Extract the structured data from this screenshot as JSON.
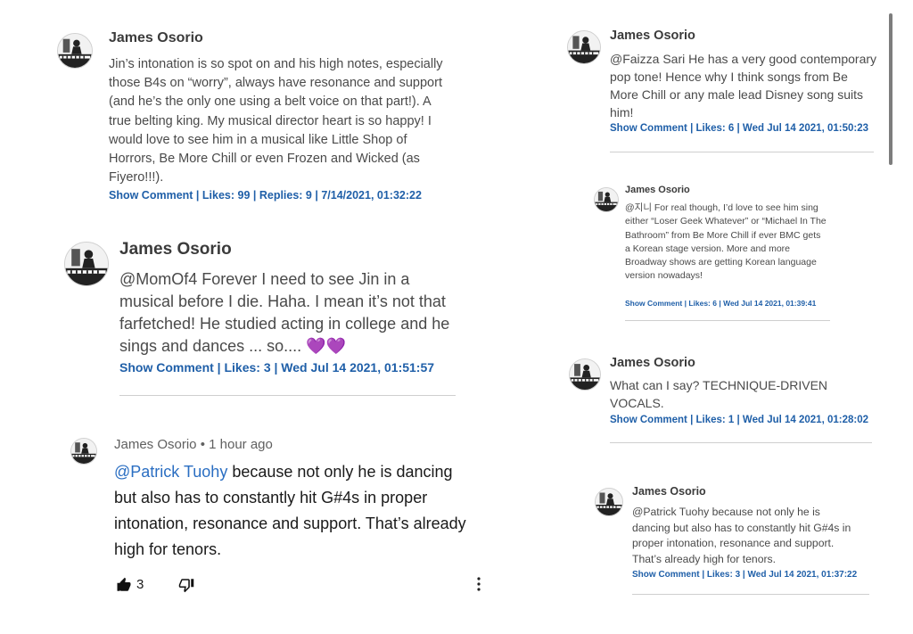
{
  "comments": [
    {
      "name": "James Osorio",
      "text": "Jin’s intonation is so spot on and his high notes, especially those B4s on “worry”, always have resonance and support (and he’s the only one using a belt voice on that part!). A true belting king. My musical director heart is so happy! I would love to see him in a musical like Little Shop of Horrors, Be More Chill or even Frozen and Wicked (as Fiyero!!!).",
      "meta": "Show Comment | Likes: 99 | Replies: 9 | 7/14/2021, 01:32:22"
    },
    {
      "name": "James Osorio",
      "text": "@MomOf4 Forever I need to see Jin in a musical before I die. Haha. I mean it’s not that farfetched! He studied acting in college and he sings and dances ... so....",
      "hearts": "💜💜",
      "meta": "Show Comment | Likes: 3 | Wed Jul 14 2021, 01:51:57"
    },
    {
      "name": "James Osorio",
      "time": "1 hour ago",
      "mention": "@Patrick Tuohy",
      "text": " because not only he is dancing but also has to constantly hit G#4s in proper intonation, resonance and support. That’s already high for tenors.",
      "likes": "3"
    },
    {
      "name": "James Osorio",
      "text": "@Faizza Sari He has a very good contemporary pop tone! Hence why I think songs from Be More Chill or any male lead Disney song suits him!",
      "meta": "Show Comment | Likes: 6 | Wed Jul 14 2021, 01:50:23"
    },
    {
      "name": "James Osorio",
      "text": "@지니 For real though, I’d love to see him sing either “Loser Geek Whatever” or “Michael In The Bathroom” from Be More Chill if ever BMC gets a Korean stage version. More and more Broadway shows are getting Korean language version nowadays!",
      "meta": "Show Comment | Likes: 6 | Wed Jul 14 2021, 01:39:41"
    },
    {
      "name": "James Osorio",
      "text": "What can I say? TECHNIQUE-DRIVEN VOCALS.",
      "meta": "Show Comment | Likes: 1 | Wed Jul 14 2021, 01:28:02"
    },
    {
      "name": "James Osorio",
      "text": "@Patrick Tuohy because not only he is dancing but also has to constantly hit G#4s in proper intonation, resonance and support. That’s already high for tenors.",
      "meta": "Show Comment | Likes: 3 | Wed Jul 14 2021, 01:37:22"
    }
  ],
  "icons": {
    "avatar": "piano-player-avatar",
    "like": "thumbs-up-icon",
    "dislike": "thumbs-down-icon",
    "more": "more-vert-icon"
  },
  "colors": {
    "link": "#1f5fa8",
    "mention": "#2a6ec2",
    "heart": "#9b2dd6"
  }
}
